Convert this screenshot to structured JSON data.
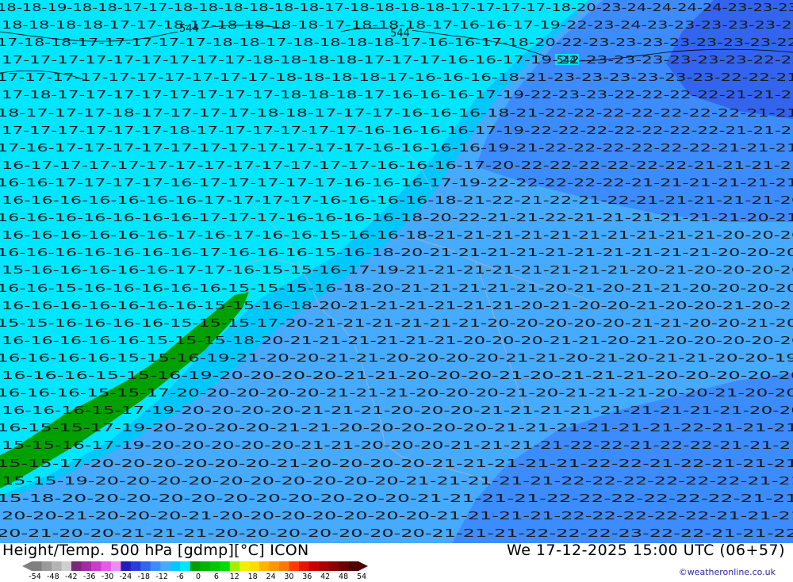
{
  "title": "Height/Temp. 500 hPa [gdmp][°C] ICON",
  "valid_time": "We 17-12-2025 15:00 UTC (06+57)",
  "credit": "©weatheronline.co.uk",
  "colorbar": {
    "ticks": [
      "-54",
      "-48",
      "-42",
      "-36",
      "-30",
      "-24",
      "-18",
      "-12",
      "-6",
      "0",
      "6",
      "12",
      "18",
      "24",
      "30",
      "36",
      "42",
      "48",
      "54"
    ],
    "colors": [
      "#7f7f7f",
      "#9a9a9a",
      "#b4b4b4",
      "#cfcfcf",
      "#7a287a",
      "#a22aa2",
      "#c83cc8",
      "#e65ae6",
      "#f08cf0",
      "#1e1ebe",
      "#283cdc",
      "#3264f0",
      "#3c8cff",
      "#46aaff",
      "#00c8ff",
      "#00e6ff",
      "#00a000",
      "#00b400",
      "#00c800",
      "#00dc00",
      "#a0f000",
      "#f0f000",
      "#ffdc00",
      "#ffb400",
      "#ff9600",
      "#ff7800",
      "#ff3c00",
      "#e61400",
      "#c80000",
      "#aa0000",
      "#8c0000",
      "#6e0000",
      "#500000"
    ]
  },
  "isohypses": [
    {
      "label": "544",
      "pos": "upper-left"
    },
    {
      "label": "544",
      "pos": "upper-center"
    },
    {
      "label": "544",
      "pos": "upper-right"
    }
  ],
  "temperature_rows": [
    "18-18-19-18-18-17-17-18-18-18-18-18-18-17-18-18-18-18-17-17-17-17-18-20-23-24-24-24-24-23-23-23",
    "18-18-18-18-17-17-18-17-18-18-18-18-17-18-18-18-17-16-16-17-19-22-23-24-23-23-23-23-23-22",
    "17-18-18-17-17-17-17-17-18-18-17-18-18-18-18-17-16-16-17-18-20-22-23-23-23-23-23-23-23-22",
    "17-17-17-17-17-17-17-17-17-18-18-18-18-17-17-17-16-16-17-19-22-23-23-23-23-23-23-22-22",
    "17-17-17-17-17-17-17-17-17-17-18-18-18-18-17-16-16-16-18-21-23-23-23-23-23-23-22-22-21",
    "17-18-17-17-17-17-17-17-17-17-18-18-18-17-16-16-16-17-19-22-23-23-22-22-22-22-21-21-21",
    "18-17-17-17-18-17-17-17-17-18-18-17-17-17-16-16-16-18-21-22-22-22-22-22-22-22-21-21",
    "17-17-17-17-17-17-18-17-17-17-17-17-17-16-16-16-16-17-19-22-22-22-22-22-22-22-21-21-21",
    "17-16-17-17-17-17-17-17-17-17-17-17-17-16-16-16-16-19-21-22-22-22-22-22-22-21-21-21",
    "16-17-17-17-17-17-17-17-17-17-17-17-17-16-16-16-17-20-22-22-22-22-22-22-21-21-21-21",
    "16-16-17-17-17-17-16-17-17-17-17-17-16-16-16-17-19-22-22-22-22-22-21-21-21-21-21-21",
    "16-16-16-16-16-16-16-17-17-17-17-16-16-16-16-18-21-22-21-22-21-22-21-21-21-21-21-20",
    "16-16-16-16-16-16-16-17-17-17-16-16-16-16-18-20-22-21-21-22-21-21-21-21-21-21-20-21",
    "16-16-16-16-16-16-17-16-17-16-16-15-16-16-18-21-21-21-21-21-21-21-21-21-21-20-20-20",
    "16-16-16-16-16-16-16-17-16-16-16-15-16-18-20-21-21-21-21-21-21-21-21-21-21-20-20-20",
    "15-16-16-16-16-16-17-17-16-15-15-16-17-19-21-21-21-21-21-21-21-21-20-21-20-20-20-20",
    "16-16-15-16-16-16-16-16-15-15-15-16-18-20-21-21-21-21-21-20-21-20-21-21-20-20-20-20",
    "16-16-16-16-16-16-16-15-15-16-18-20-21-21-21-21-21-21-20-21-20-20-21-20-20-21-20-21",
    "15-15-16-16-16-16-15-15-15-17-20-21-21-21-21-21-21-20-20-20-20-20-21-21-20-20-21-20",
    "16-16-16-16-16-15-15-15-18-20-21-21-21-21-21-21-20-20-20-21-21-20-21-20-20-20-20-20",
    "16-16-16-16-15-15-16-19-21-20-20-21-21-20-20-20-20-21-21-20-21-20-21-21-20-20-19",
    "16-16-16-15-15-16-19-20-20-20-20-21-21-20-20-20-21-20-21-21-21-20-20-20-20-20",
    "16-16-16-15-15-17-20-20-20-20-20-21-21-21-20-20-20-21-20-21-21-21-20-20-21-20-20",
    "16-16-16-15-17-19-20-20-20-20-21-21-21-20-20-20-21-21-21-21-21-21-21-21-21-20-20",
    "16-15-15-17-19-20-20-20-20-21-21-20-20-20-20-20-21-21-21-21-21-21-22-21-21-21",
    "15-15-16-17-19-20-20-20-20-20-21-21-20-20-20-21-21-21-21-22-22-21-22-22-21-21-21",
    "15-15-17-20-20-20-20-20-20-21-20-20-20-20-21-21-21-21-21-22-22-21-22-21-21-21",
    "15-15-19-20-20-20-20-20-20-20-20-20-20-21-21-21-21-21-22-22-22-22-22-22-21-21",
    "15-18-20-20-20-20-20-20-20-20-20-20-20-21-21-21-21-22-22-22-22-22-22-21-21",
    "20-20-21-20-20-20-21-20-20-20-20-20-20-20-21-21-21-21-22-22-22-22-22-21-21-21",
    "20-21-20-20-21-21-21-20-20-20-20-20-20-20-21-21-21-22-22-22-23-22-22-21-21-22"
  ]
}
